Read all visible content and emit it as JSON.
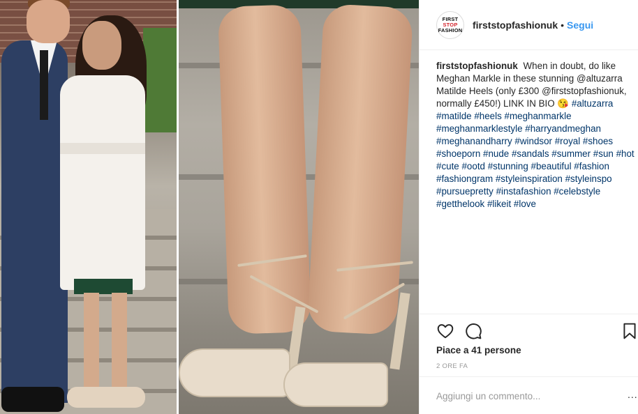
{
  "post": {
    "username": "firststopfashionuk",
    "separator": "•",
    "follow_label": "Segui",
    "avatar_lines": [
      "FIRST",
      "STOP",
      "FASHION"
    ],
    "caption_text": "When in doubt, do like Meghan Markle in these stunning @altuzarra Matilde Heels (only £300 @firststopfashionuk, normally £450!) LINK IN BIO 😘",
    "hashtags": "#altuzarra #matilde #heels #meghanmarkle #meghanmarklestyle #harryandmeghan #meghanandharry #windsor #royal #shoes #shoeporn #nude #sandals #summer #sun #hot #cute #ootd #stunning #beautiful #fashion #fashiongram #styleinspiration #styleinspo #pursuepretty #instafashion #celebstyle #getthelook #likeit #love",
    "likes_text": "Piace a 41 persone",
    "time_text": "2 ORE FA",
    "comment_placeholder": "Aggiungi un commento...",
    "more_text": "..."
  },
  "icons": {
    "like": "heart-outline-icon",
    "comment": "speech-bubble-icon",
    "save": "bookmark-icon"
  },
  "colors": {
    "link": "#3897f0",
    "hashtag": "#003569",
    "text": "#262626",
    "muted": "#999999"
  }
}
